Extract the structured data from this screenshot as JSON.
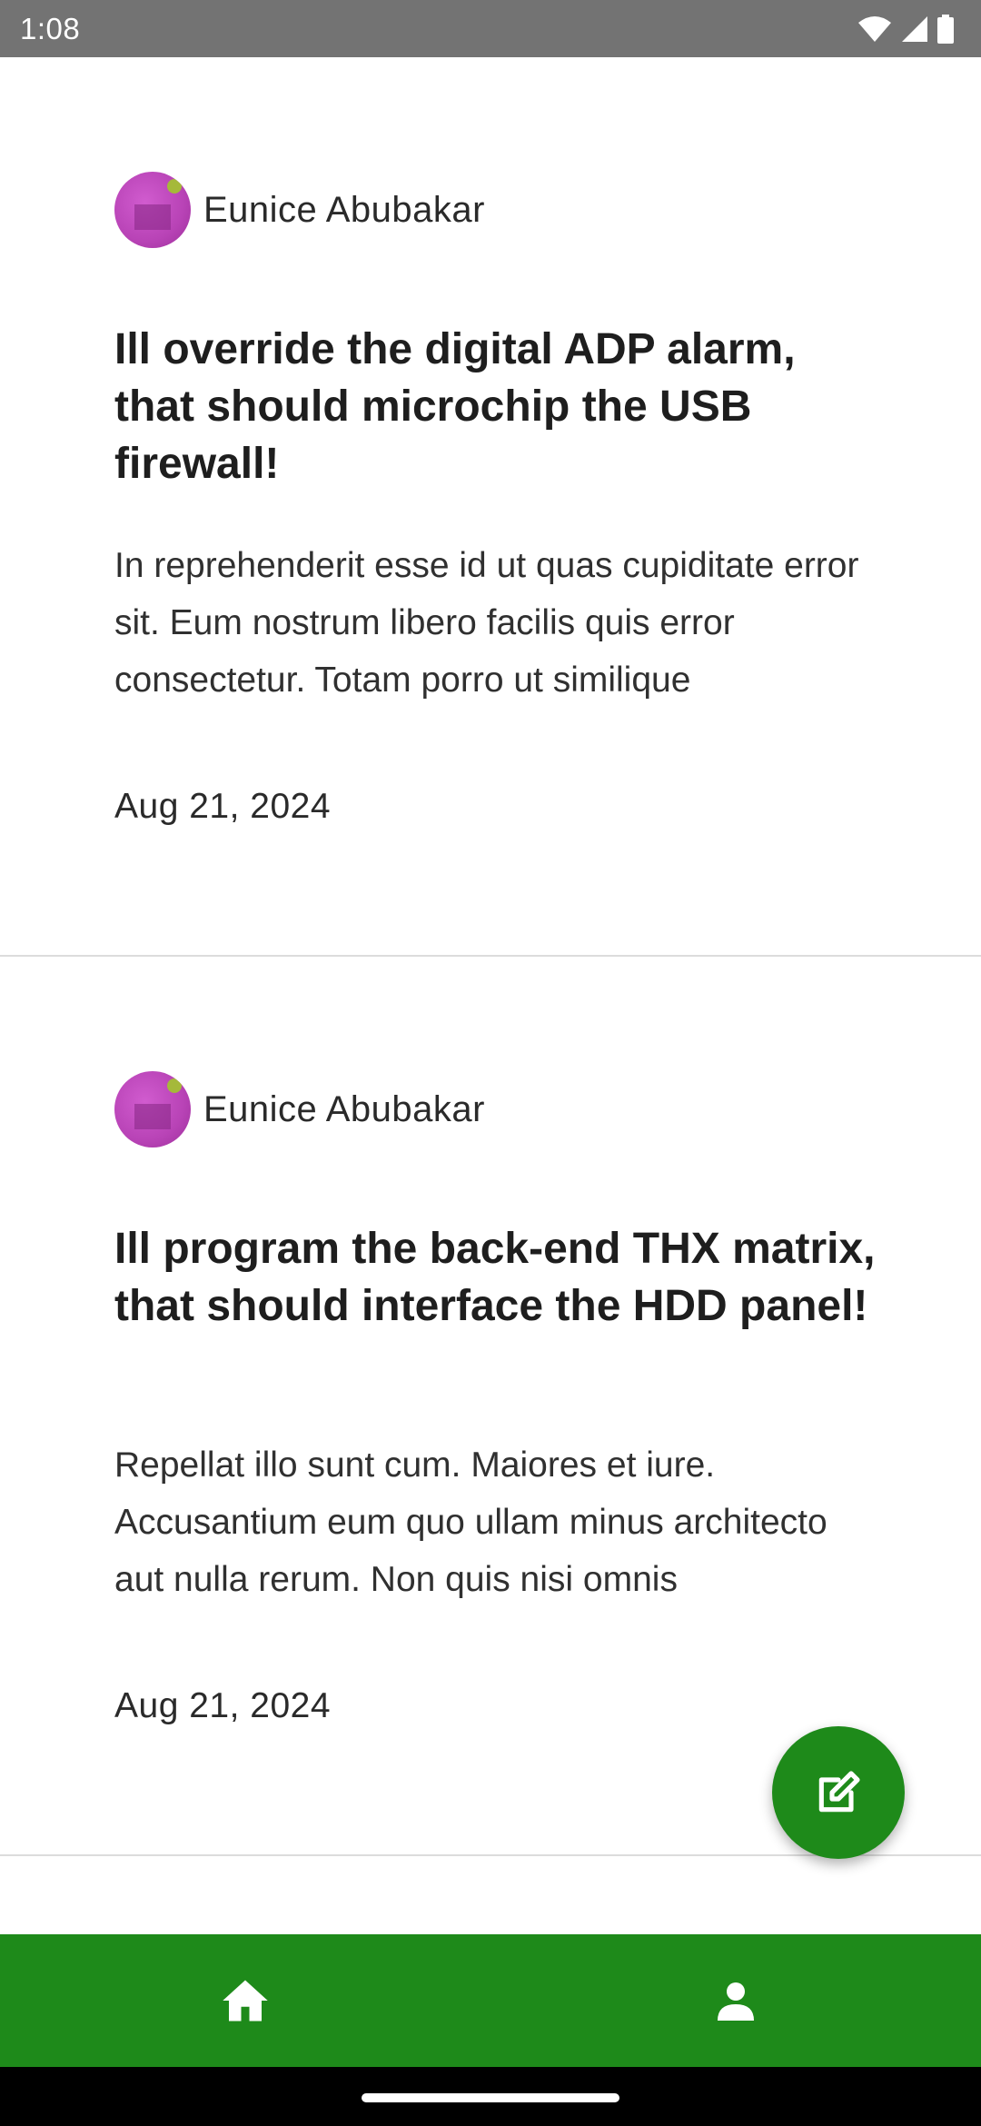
{
  "status_bar": {
    "time": "1:08",
    "icons": [
      "wifi-icon",
      "cell-signal-icon",
      "battery-icon"
    ]
  },
  "posts": [
    {
      "author": "Eunice Abubakar",
      "title": "Ill override the digital ADP alarm, that should microchip the USB firewall!",
      "excerpt": "In reprehenderit esse id ut quas cupiditate error sit. Eum nostrum libero facilis quis error consectetur. Totam porro ut similique",
      "date": "Aug 21, 2024"
    },
    {
      "author": "Eunice Abubakar",
      "title": "Ill program the back-end THX matrix, that should interface the HDD panel!",
      "excerpt": "Repellat illo sunt cum. Maiores et iure. Accusantium eum quo ullam minus architecto aut nulla rerum. Non quis nisi omnis",
      "date": "Aug 21, 2024"
    }
  ],
  "fab": {
    "icon": "edit-icon"
  },
  "bottom_nav": {
    "items": [
      {
        "icon": "home-icon"
      },
      {
        "icon": "person-icon"
      }
    ]
  },
  "colors": {
    "accent": "#1e8a1a",
    "status_bar": "#737373",
    "avatar": "#b843b6"
  }
}
